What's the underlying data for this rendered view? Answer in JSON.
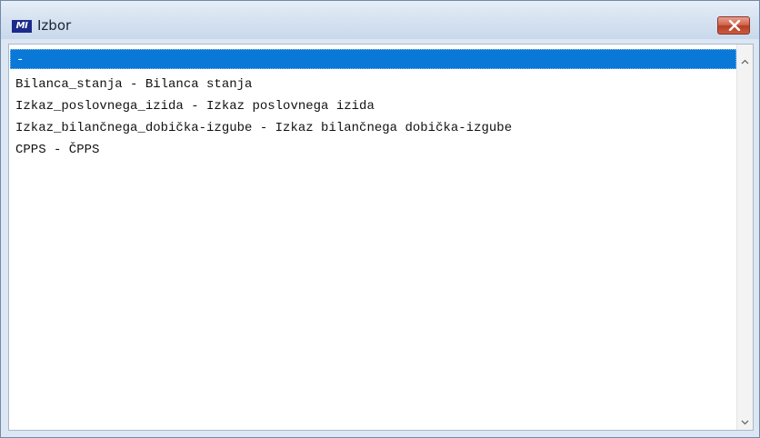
{
  "window": {
    "title": "Izbor",
    "app_icon_text": "MI"
  },
  "list": {
    "items": [
      {
        "label": "-",
        "selected": true
      },
      {
        "label": "Bilanca_stanja - Bilanca stanja",
        "selected": false
      },
      {
        "label": "Izkaz_poslovnega_izida - Izkaz poslovnega izida",
        "selected": false
      },
      {
        "label": "Izkaz_bilančnega_dobička-izgube - Izkaz bilančnega dobička-izgube",
        "selected": false
      },
      {
        "label": "CPPS - ČPPS",
        "selected": false
      }
    ]
  },
  "colors": {
    "selection": "#0a78d7",
    "close_button": "#c9513a",
    "titlebar": "#d7e3f1"
  },
  "icons": {
    "app": "app-logo-icon",
    "close": "close-icon",
    "scroll_up": "chevron-up-icon",
    "scroll_down": "chevron-down-icon"
  }
}
